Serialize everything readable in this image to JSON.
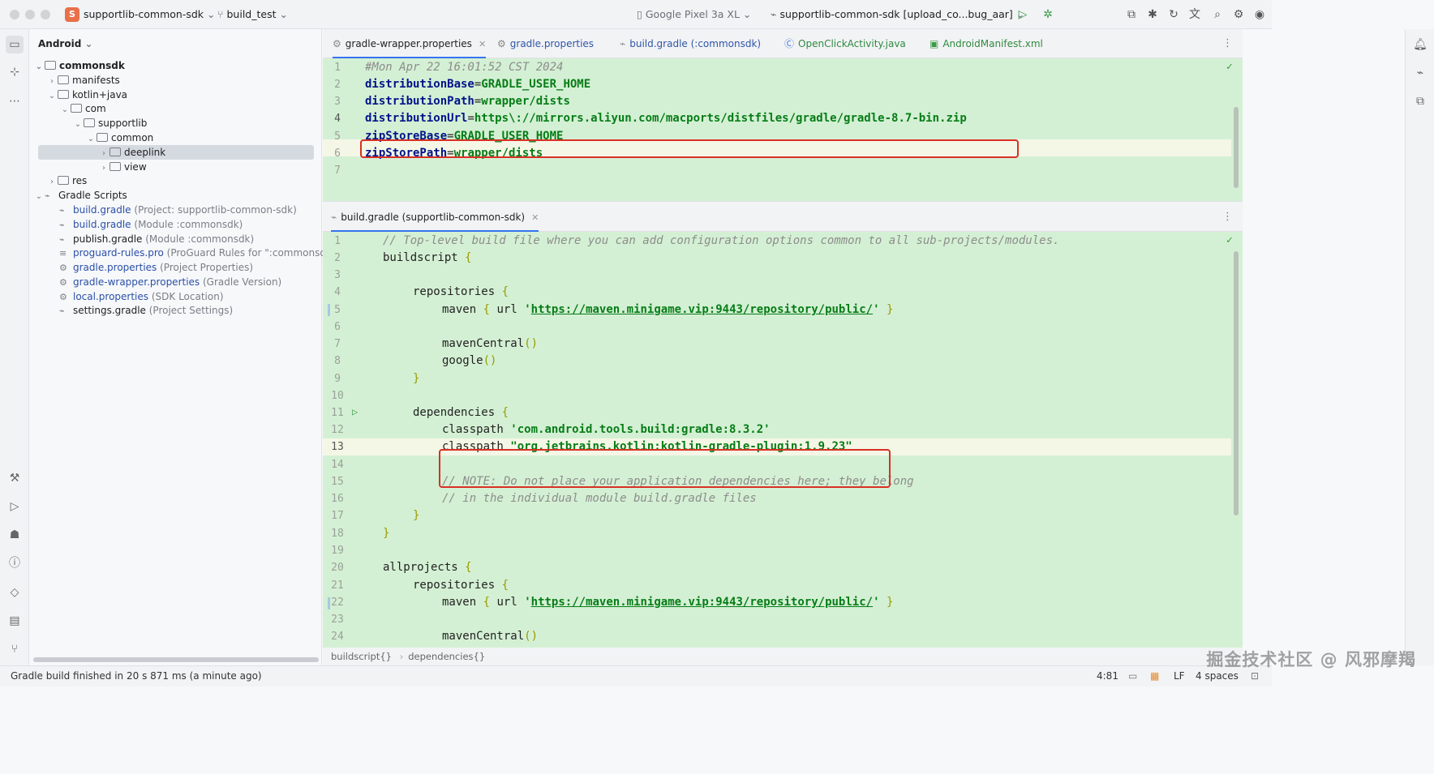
{
  "window": {
    "project_badge": "S",
    "project_name": "supportlib-common-sdk",
    "branch": "build_test",
    "device": "Google Pixel 3a XL",
    "run_config": "supportlib-common-sdk [upload_co...bug_aar]"
  },
  "project_panel": {
    "view_mode": "Android",
    "tree": [
      {
        "label": "commonsdk",
        "bold": true
      },
      {
        "label": "manifests"
      },
      {
        "label": "kotlin+java"
      },
      {
        "label": "com"
      },
      {
        "label": "supportlib"
      },
      {
        "label": "common"
      },
      {
        "label": "deeplink"
      },
      {
        "label": "view"
      },
      {
        "label": "res"
      },
      {
        "label": "Gradle Scripts"
      },
      {
        "label": "build.gradle",
        "hint": "(Project: supportlib-common-sdk)"
      },
      {
        "label": "build.gradle",
        "hint": "(Module :commonsdk)"
      },
      {
        "label": "publish.gradle",
        "hint": "(Module :commonsdk)"
      },
      {
        "label": "proguard-rules.pro",
        "hint": "(ProGuard Rules for \":commonsdk\")"
      },
      {
        "label": "gradle.properties",
        "hint": "(Project Properties)"
      },
      {
        "label": "gradle-wrapper.properties",
        "hint": "(Gradle Version)"
      },
      {
        "label": "local.properties",
        "hint": "(SDK Location)"
      },
      {
        "label": "settings.gradle",
        "hint": "(Project Settings)"
      }
    ]
  },
  "top_tabs": [
    {
      "label": "gradle-wrapper.properties",
      "active": true
    },
    {
      "label": "gradle.properties"
    },
    {
      "label": "build.gradle (:commonsdk)"
    },
    {
      "label": "OpenClickActivity.java"
    },
    {
      "label": "AndroidManifest.xml"
    }
  ],
  "top_editor": {
    "lines": [
      {
        "n": "1",
        "comment": "#Mon Apr 22 16:01:52 CST 2024"
      },
      {
        "n": "2",
        "key": "distributionBase",
        "value": "GRADLE_USER_HOME"
      },
      {
        "n": "3",
        "key": "distributionPath",
        "value": "wrapper/dists"
      },
      {
        "n": "4",
        "key": "distributionUrl",
        "value": "https\\://mirrors.aliyun.com/macports/distfiles/gradle/gradle-8.7-bin.zip"
      },
      {
        "n": "5",
        "key": "zipStoreBase",
        "value": "GRADLE_USER_HOME"
      },
      {
        "n": "6",
        "key": "zipStorePath",
        "value": "wrapper/dists"
      },
      {
        "n": "7"
      }
    ]
  },
  "bottom_tab": {
    "label": "build.gradle (supportlib-common-sdk)"
  },
  "bottom_editor": {
    "line_numbers": [
      "1",
      "2",
      "3",
      "4",
      "5",
      "6",
      "7",
      "8",
      "9",
      "10",
      "11",
      "12",
      "13",
      "14",
      "15",
      "16",
      "17",
      "18",
      "19",
      "20",
      "21",
      "22",
      "23",
      "24"
    ],
    "text": {
      "l1": "// Top-level build file where you can add configuration options common to all sub-projects/modules.",
      "buildscript": "buildscript",
      "repositories": "repositories",
      "maven": "maven",
      "url": "url",
      "maven_url": "https://maven.minigame.vip:9443/repository/public/",
      "mavenCentral": "mavenCentral",
      "google": "google",
      "dependencies": "dependencies",
      "classpath": "classpath",
      "cp1": "'com.android.tools.build:gradle:8.3.2'",
      "cp2": "\"org.jetbrains.kotlin:kotlin-gradle-plugin:1.9.23\"",
      "l15": "// NOTE: Do not place your application dependencies here; they belong",
      "l16": "// in the individual module build.gradle files",
      "allprojects": "allprojects"
    }
  },
  "breadcrumbs": [
    "buildscript{}",
    "dependencies{}"
  ],
  "status": {
    "message": "Gradle build finished in 20 s 871 ms (a minute ago)",
    "position": "4:81",
    "line_sep": "LF",
    "indent": "4 spaces"
  },
  "watermark": "掘金技术社区 @ 风邪摩羯"
}
